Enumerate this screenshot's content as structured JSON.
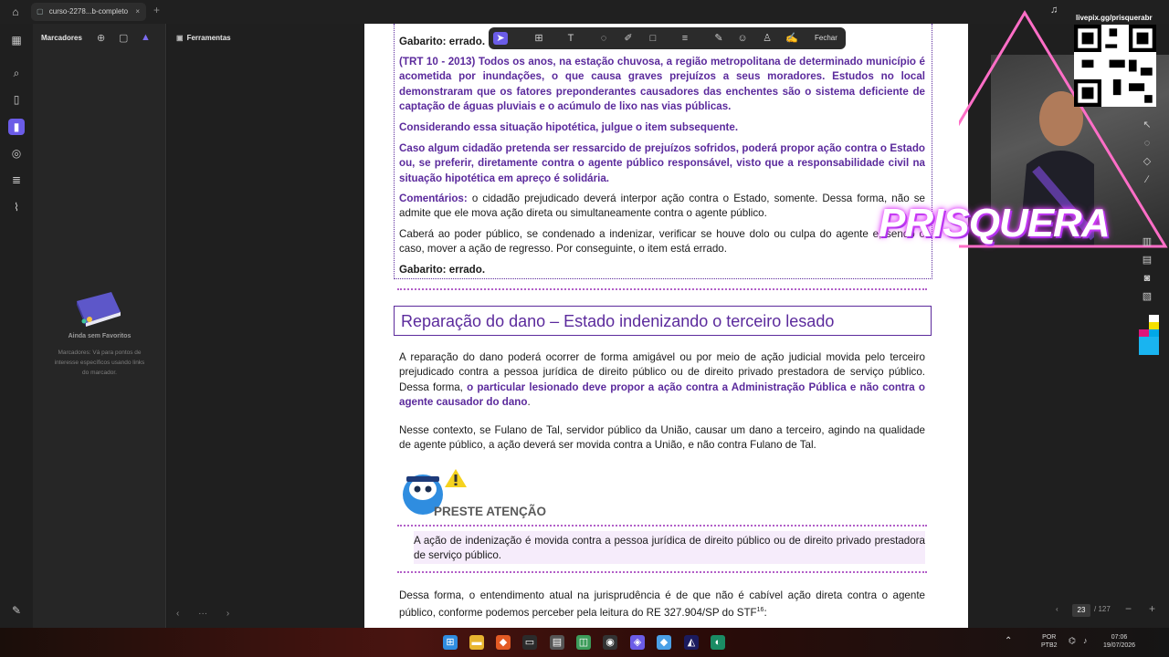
{
  "browser": {
    "tab_title": "curso-2278...b-completo",
    "tab_close": "×",
    "new_tab": "+"
  },
  "bookmarks_panel": {
    "title": "Marcadores",
    "empty_title": "Ainda sem Favoritos",
    "empty_desc": "Marcadores: Vá para pontos de interesse específicos usando links do marcador."
  },
  "tools_panel": {
    "title": "Ferramentas"
  },
  "annotation_toolbar": {
    "close_label": "Fechar"
  },
  "document": {
    "partial_top": "Gabarito: errado.",
    "q_header": "(TRT 10 - 2013) Todos os anos, na estação chuvosa, a região metropolitana de determinado município é acometida por inundações, o que causa graves prejuízos a seus moradores. Estudos no local demonstraram que os fatores preponderantes causadores das enchentes são o sistema deficiente de captação de águas pluviais e o acúmulo de lixo nas vias públicas.",
    "q_consider": "Considerando essa situação hipotética, julgue o item subsequente.",
    "q_item": "Caso algum cidadão pretenda ser ressarcido de prejuízos sofridos, poderá propor ação contra o Estado ou, se preferir, diretamente contra o agente público responsável, visto que a responsabilidade civil na situação hipotética em apreço é solidária.",
    "comment_label": "Comentários:",
    "comment_text": " o cidadão prejudicado deverá interpor ação contra o Estado, somente. Dessa forma, não se admite que ele mova ação direta ou simultaneamente contra o agente público.",
    "comment_2": "Caberá ao poder público, se condenado a indenizar, verificar se houve dolo ou culpa do agente e, sendo o caso, mover a ação de regresso. Por conseguinte, o item está errado.",
    "answer": "Gabarito: errado.",
    "section_title": "Reparação do dano – Estado indenizando o terceiro lesado",
    "para1_a": "A reparação do dano poderá ocorrer de forma amigável ou por meio de ação judicial movida pelo terceiro prejudicado contra a pessoa jurídica de direito público ou de direito privado prestadora de serviço público. Dessa forma, ",
    "para1_b": "o particular lesionado deve propor a ação contra a Administração Pública e não contra o agente causador do dano",
    "para1_c": ".",
    "para2": "Nesse contexto, se Fulano de Tal, servidor público da União, causar um dano a terceiro, agindo na qualidade de agente público, a ação deverá ser movida contra a União, e não contra Fulano de Tal.",
    "attention_label": "PRESTE ATENÇÃO",
    "attention_text": "A ação de indenização é movida contra a pessoa jurídica de direito público ou de direito privado prestadora de serviço público.",
    "para3": "Dessa forma, o entendimento atual na jurisprudência é de que não é cabível ação direta contra o agente público, conforme podemos perceber pela leitura do RE 327.904/SP do STF",
    "footnote_ref": "16",
    "para3_end": ":"
  },
  "overlay": {
    "streamer_name": "PRISQUERA",
    "qr_label": "livepix.gg/prisquerabr"
  },
  "page_nav": {
    "current": "23",
    "total": "/ 127"
  },
  "taskbar": {
    "lang_top": "POR",
    "lang_bottom": "PTB2",
    "time": "07:06",
    "date": "19/07/2026"
  },
  "colors": {
    "accent": "#6b5ce7",
    "doc_purple": "#5b2a9c"
  }
}
